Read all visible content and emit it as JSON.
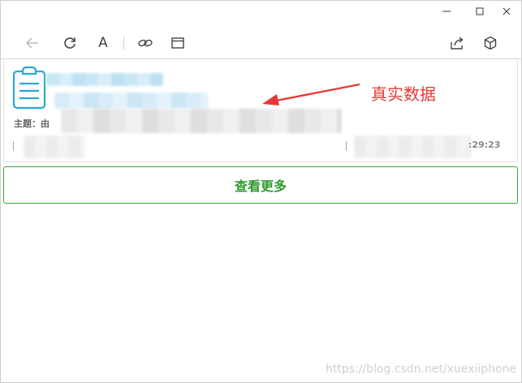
{
  "titlebar": {
    "icons": [
      "minimize-icon",
      "maximize-icon",
      "close-icon"
    ]
  },
  "toolbar": {
    "font_glyph": "A",
    "icons": [
      "back-arrow-icon",
      "refresh-icon",
      "font-icon",
      "link-icon",
      "window-icon",
      "share-icon",
      "cube-icon"
    ]
  },
  "message": {
    "subject_label": "主题：由",
    "time_suffix": ":29:23",
    "icon": "clipboard-icon"
  },
  "annotation": {
    "text": "真实数据"
  },
  "actions": {
    "see_more_label": "查看更多"
  },
  "watermark": {
    "text": "https://blog.csdn.net/xuexiiphone"
  },
  "colors": {
    "accent_green": "#2e9a2e",
    "annotation_red": "#e53935",
    "icon_blue": "#2aa8d8"
  }
}
